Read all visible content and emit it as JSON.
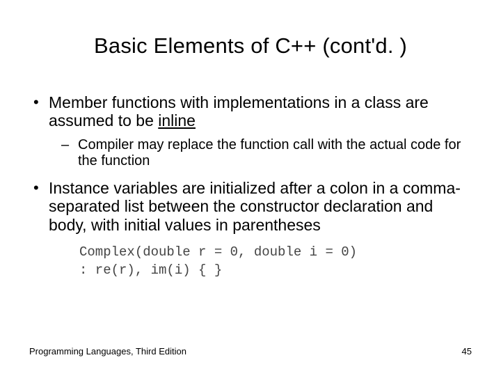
{
  "slide": {
    "title": "Basic Elements of C++ (cont'd. )",
    "bullets": [
      {
        "text_pre": "Member functions with implementations in a class are assumed to be ",
        "text_underlined": "inline",
        "text_post": "",
        "sub": [
          {
            "text": "Compiler may replace the function call with the actual code for the function"
          }
        ]
      },
      {
        "text_pre": "Instance variables are initialized after a colon in a comma-separated list between the constructor declaration and body, with initial values in parentheses",
        "text_underlined": "",
        "text_post": "",
        "sub": []
      }
    ],
    "code": {
      "line1": "Complex(double r = 0, double i = 0)",
      "line2": ": re(r), im(i) { }"
    },
    "footer_left": "Programming Languages, Third Edition",
    "footer_right": "45"
  }
}
